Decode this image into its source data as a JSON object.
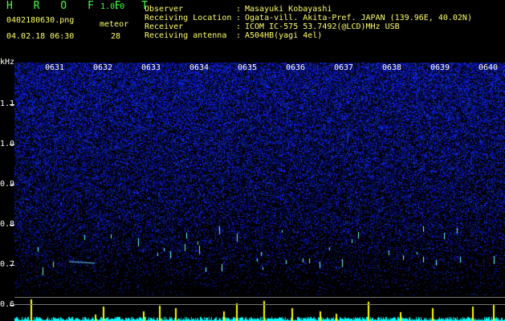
{
  "header": {
    "app_title": "H R O F F T",
    "version": "1.0.0",
    "filename": "0402180630.png",
    "datetime": "04.02.18 06:30",
    "meteor_label": "meteor",
    "meteor_count": "28",
    "fields": [
      {
        "label": "Observer",
        "value": "Masayuki Kobayashi"
      },
      {
        "label": "Receiving Location",
        "value": "Ogata-vill. Akita-Pref. JAPAN (139.96E, 40.02N)"
      },
      {
        "label": "Receiver",
        "value": "ICOM IC-575 53.7492(@LCD)MHz USB"
      },
      {
        "label": "Receiving antenna",
        "value": "A504HB(yagi 4el)"
      }
    ],
    "separator": ":"
  },
  "plot": {
    "y_unit": "kHz",
    "y_ticks": [
      "1.1",
      "1.0",
      "0.9",
      "0.8",
      "0.7",
      "0.6"
    ],
    "x_ticks": [
      "0631",
      "0632",
      "0633",
      "0634",
      "0635",
      "0636",
      "0637",
      "0638",
      "0639",
      "0640"
    ],
    "colors": {
      "noise": "#1a2bd8",
      "background": "#000000",
      "signal": "#ffff00",
      "baseline": "#00ffff"
    }
  }
}
